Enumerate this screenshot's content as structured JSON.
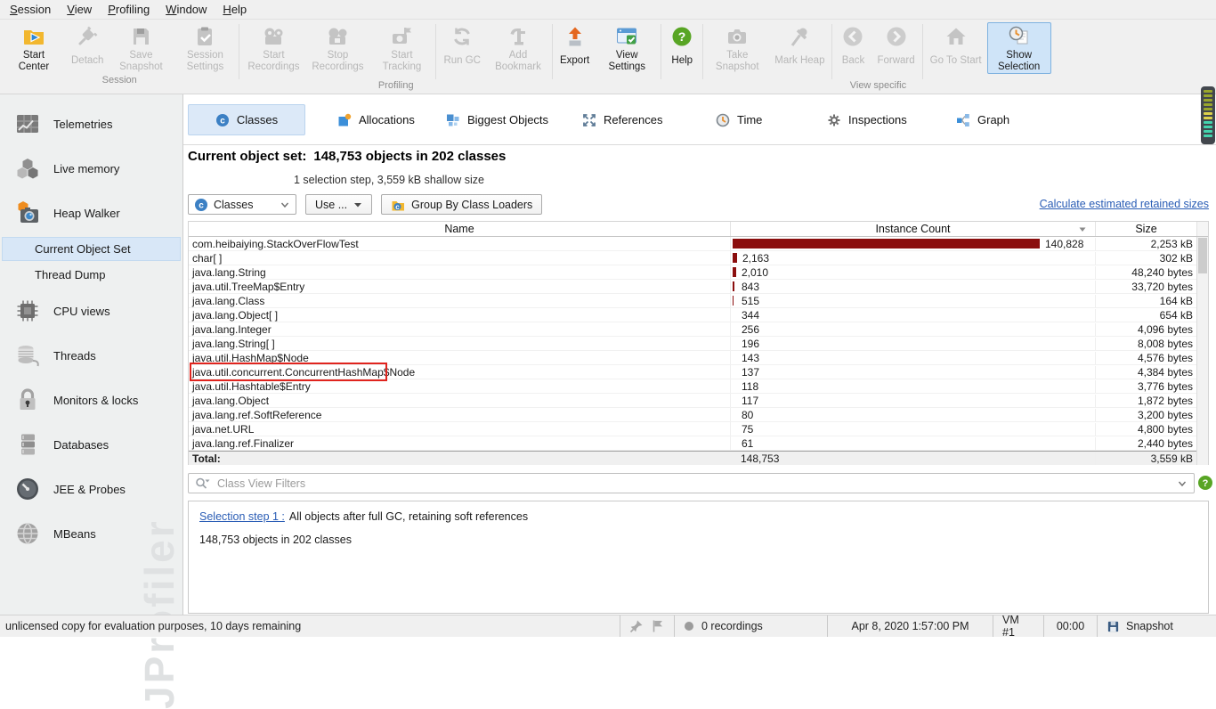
{
  "menu": {
    "items": [
      "Session",
      "View",
      "Profiling",
      "Window",
      "Help"
    ]
  },
  "toolbar": {
    "groups": [
      {
        "label": "Session",
        "sections": [
          [
            {
              "label": "Start Center",
              "icon": "start-center",
              "enabled": true
            },
            {
              "label": "Detach",
              "icon": "detach",
              "enabled": false
            },
            {
              "label": "Save Snapshot",
              "icon": "save-snapshot",
              "enabled": false
            },
            {
              "label": "Session Settings",
              "icon": "session-settings",
              "enabled": false
            }
          ]
        ]
      },
      {
        "label": "Profiling",
        "sections": [
          [
            {
              "label": "Start Recordings",
              "icon": "start-recordings",
              "enabled": false
            },
            {
              "label": "Stop Recordings",
              "icon": "stop-recordings",
              "enabled": false
            },
            {
              "label": "Start Tracking",
              "icon": "start-tracking",
              "enabled": false
            }
          ],
          [
            {
              "label": "Run GC",
              "icon": "run-gc",
              "enabled": false
            },
            {
              "label": "Add Bookmark",
              "icon": "add-bookmark",
              "enabled": false
            }
          ]
        ]
      },
      {
        "label": "",
        "sections": [
          [
            {
              "label": "Export",
              "icon": "export",
              "enabled": true
            },
            {
              "label": "View Settings",
              "icon": "view-settings",
              "enabled": true
            }
          ]
        ]
      },
      {
        "label": "",
        "sections": [
          [
            {
              "label": "Help",
              "icon": "help",
              "enabled": true
            }
          ]
        ]
      },
      {
        "label": "View specific",
        "sections": [
          [
            {
              "label": "Take Snapshot",
              "icon": "take-snapshot",
              "enabled": false
            },
            {
              "label": "Mark Heap",
              "icon": "mark-heap",
              "enabled": false
            }
          ],
          [
            {
              "label": "Back",
              "icon": "back",
              "enabled": false
            },
            {
              "label": "Forward",
              "icon": "forward",
              "enabled": false
            }
          ],
          [
            {
              "label": "Go To Start",
              "icon": "go-to-start",
              "enabled": false
            },
            {
              "label": "Show Selection",
              "icon": "show-selection",
              "enabled": true,
              "selected": true
            }
          ]
        ]
      }
    ]
  },
  "sidebar": {
    "items": [
      {
        "label": "Telemetries",
        "icon": "telemetries"
      },
      {
        "label": "Live memory",
        "icon": "live-memory"
      },
      {
        "label": "Heap Walker",
        "icon": "heap-walker"
      },
      {
        "label": "Current Object Set",
        "sub": true,
        "selected": true
      },
      {
        "label": "Thread Dump",
        "sub": true
      },
      {
        "label": "CPU views",
        "icon": "cpu-views"
      },
      {
        "label": "Threads",
        "icon": "threads"
      },
      {
        "label": "Monitors & locks",
        "icon": "monitors-locks"
      },
      {
        "label": "Databases",
        "icon": "databases"
      },
      {
        "label": "JEE & Probes",
        "icon": "jee-probes"
      },
      {
        "label": "MBeans",
        "icon": "mbeans"
      }
    ],
    "watermark": "JProfiler"
  },
  "tabs": [
    {
      "label": "Classes",
      "icon": "classes",
      "selected": true
    },
    {
      "label": "Allocations",
      "icon": "allocations"
    },
    {
      "label": "Biggest Objects",
      "icon": "biggest-objects"
    },
    {
      "label": "References",
      "icon": "references"
    },
    {
      "label": "Time",
      "icon": "time"
    },
    {
      "label": "Inspections",
      "icon": "inspections"
    },
    {
      "label": "Graph",
      "icon": "graph"
    }
  ],
  "heading": {
    "prefix": "Current object set:",
    "title": "148,753 objects in 202 classes",
    "subtitle": "1 selection step, 3,559 kB shallow size"
  },
  "controls": {
    "view_mode": "Classes",
    "use_button": "Use ...",
    "group_by": "Group By Class Loaders",
    "retained_link": "Calculate estimated retained sizes"
  },
  "table": {
    "columns": [
      "Name",
      "Instance Count",
      "Size"
    ],
    "rows": [
      {
        "name": "com.heibaiying.StackOverFlowTest",
        "count": "140,828",
        "size": "2,253 kB"
      },
      {
        "name": "char[ ]",
        "count": "2,163",
        "size": "302 kB"
      },
      {
        "name": "java.lang.String",
        "count": "2,010",
        "size": "48,240 bytes"
      },
      {
        "name": "java.util.TreeMap$Entry",
        "count": "843",
        "size": "33,720 bytes"
      },
      {
        "name": "java.lang.Class",
        "count": "515",
        "size": "164 kB"
      },
      {
        "name": "java.lang.Object[ ]",
        "count": "344",
        "size": "654 kB"
      },
      {
        "name": "java.lang.Integer",
        "count": "256",
        "size": "4,096 bytes"
      },
      {
        "name": "java.lang.String[ ]",
        "count": "196",
        "size": "8,008 bytes"
      },
      {
        "name": "java.util.HashMap$Node",
        "count": "143",
        "size": "4,576 bytes"
      },
      {
        "name": "java.util.concurrent.ConcurrentHashMap$Node",
        "count": "137",
        "size": "4,384 bytes"
      },
      {
        "name": "java.util.Hashtable$Entry",
        "count": "118",
        "size": "3,776 bytes"
      },
      {
        "name": "java.lang.Object",
        "count": "117",
        "size": "1,872 bytes"
      },
      {
        "name": "java.lang.ref.SoftReference",
        "count": "80",
        "size": "3,200 bytes"
      },
      {
        "name": "java.net.URL",
        "count": "75",
        "size": "4,800 bytes"
      },
      {
        "name": "java.lang.ref.Finalizer",
        "count": "61",
        "size": "2,440 bytes"
      }
    ],
    "total": {
      "name": "Total:",
      "count": "148,753",
      "size": "3,559 kB"
    },
    "annotation": {
      "row": 0,
      "color": "#e0241e"
    }
  },
  "filter": {
    "placeholder": "Class View Filters"
  },
  "selection_panel": {
    "link": "Selection step 1 :",
    "text": "All objects after full GC, retaining soft references",
    "summary": "148,753 objects in 202 classes"
  },
  "status_bar": {
    "left": "unlicensed copy for evaluation purposes, 10 days remaining",
    "recordings": "0 recordings",
    "datetime": "Apr 8, 2020 1:57:00 PM",
    "vm": "VM #1",
    "elapsed": "00:00",
    "snapshot": "Snapshot"
  },
  "colors": {
    "bar_red": "#8b0e0e",
    "link": "#2a5db5",
    "accent_blue": "#3c80c4",
    "selection_bg": "#d8e7f7",
    "annotation_red": "#e0241e"
  }
}
